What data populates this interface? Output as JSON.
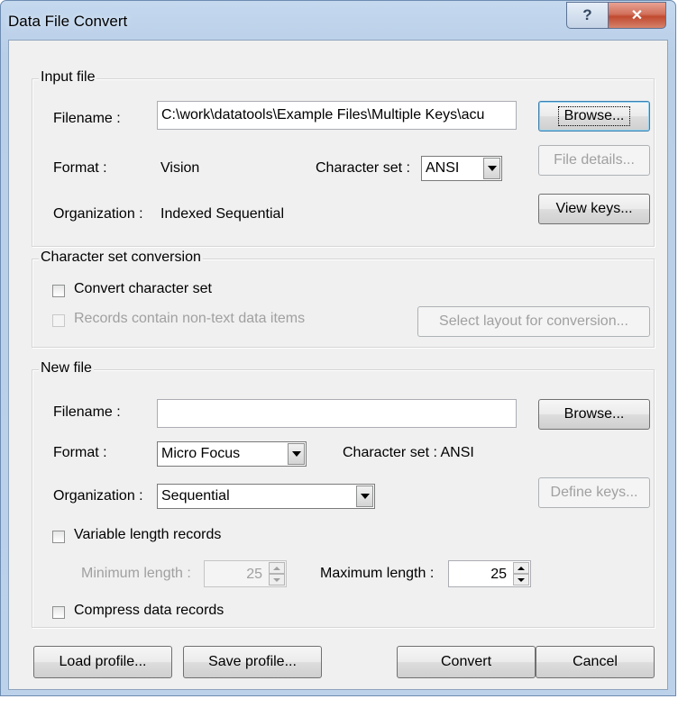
{
  "window": {
    "title": "Data File Convert",
    "help_glyph": "?",
    "close_glyph": "✕"
  },
  "input_file": {
    "legend": "Input file",
    "filename_label": "Filename :",
    "filename_value": "C:\\work\\datatools\\Example Files\\Multiple Keys\\acu",
    "browse_label": "Browse...",
    "format_label": "Format :",
    "format_value": "Vision",
    "charset_label": "Character set :",
    "charset_value": "ANSI",
    "file_details_label": "File details...",
    "organization_label": "Organization :",
    "organization_value": "Indexed Sequential",
    "view_keys_label": "View keys..."
  },
  "charset_conversion": {
    "legend": "Character set conversion",
    "convert_label": "Convert character set",
    "convert_checked": false,
    "records_label": "Records contain non-text data items",
    "records_checked": false,
    "select_layout_label": "Select layout for conversion..."
  },
  "new_file": {
    "legend": "New file",
    "filename_label": "Filename :",
    "filename_value": "",
    "browse_label": "Browse...",
    "format_label": "Format :",
    "format_value": "Micro Focus",
    "charset_text": "Character set :  ANSI",
    "organization_label": "Organization :",
    "organization_value": "Sequential",
    "define_keys_label": "Define keys...",
    "variable_length_label": "Variable length records",
    "variable_length_checked": false,
    "min_length_label": "Minimum length :",
    "min_length_value": "25",
    "max_length_label": "Maximum length :",
    "max_length_value": "25",
    "compress_label": "Compress data records",
    "compress_checked": false
  },
  "footer": {
    "load_profile_label": "Load profile...",
    "save_profile_label": "Save profile...",
    "convert_label": "Convert",
    "cancel_label": "Cancel"
  },
  "colors": {
    "frame": "#bcd1ea",
    "client": "#f0f0f0",
    "close_button": "#c75039",
    "disabled_text": "#a0a0a0"
  }
}
